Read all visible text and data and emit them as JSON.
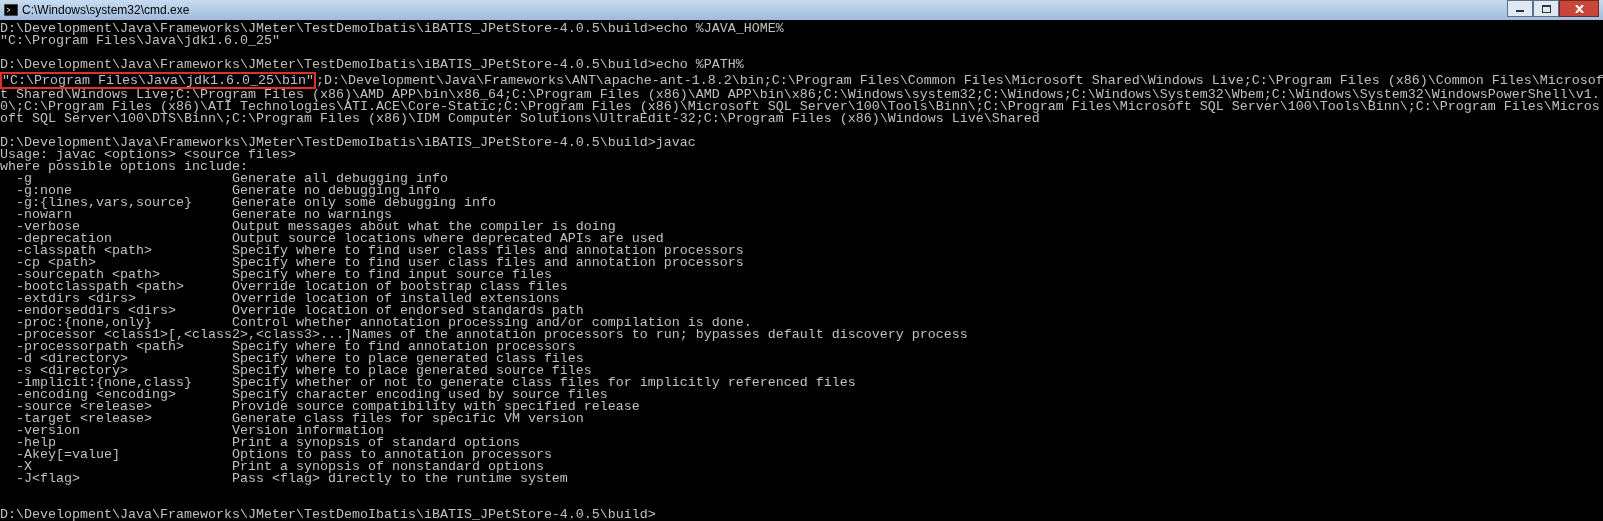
{
  "window": {
    "title": "C:\\Windows\\system32\\cmd.exe"
  },
  "console": {
    "lines": [
      {
        "kind": "text",
        "text": "D:\\Development\\Java\\Frameworks\\JMeter\\TestDemoIbatis\\iBATIS_JPetStore-4.0.5\\build>echo %JAVA_HOME%"
      },
      {
        "kind": "text",
        "text": "\"C:\\Program Files\\Java\\jdk1.6.0_25\""
      },
      {
        "kind": "blank"
      },
      {
        "kind": "text",
        "text": "D:\\Development\\Java\\Frameworks\\JMeter\\TestDemoIbatis\\iBATIS_JPetStore-4.0.5\\build>echo %PATH%"
      },
      {
        "kind": "parts",
        "parts": [
          {
            "text": "\"C:\\Program Files\\Java\\jdk1.6.0_25\\bin\"",
            "highlighted": true
          },
          {
            "text": ";D:\\Development\\Java\\Frameworks\\ANT\\apache-ant-1.8.2\\bin;C:\\Program Files\\Common Files\\Microsoft Shared\\Windows Live;C:\\Program Files (x86)\\Common Files\\Microsof",
            "highlighted": false
          }
        ]
      },
      {
        "kind": "text",
        "text": "t Shared\\Windows Live;C:\\Program Files (x86)\\AMD APP\\bin\\x86_64;C:\\Program Files (x86)\\AMD APP\\bin\\x86;C:\\Windows\\system32;C:\\Windows;C:\\Windows\\System32\\Wbem;C:\\Windows\\System32\\WindowsPowerShell\\v1."
      },
      {
        "kind": "text",
        "text": "0\\;C:\\Program Files (x86)\\ATI Technologies\\ATI.ACE\\Core-Static;C:\\Program Files (x86)\\Microsoft SQL Server\\100\\Tools\\Binn\\;C:\\Program Files\\Microsoft SQL Server\\100\\Tools\\Binn\\;C:\\Program Files\\Micros"
      },
      {
        "kind": "text",
        "text": "oft SQL Server\\100\\DTS\\Binn\\;C:\\Program Files (x86)\\IDM Computer Solutions\\UltraEdit-32;C:\\Program Files (x86)\\Windows Live\\Shared"
      },
      {
        "kind": "blank"
      },
      {
        "kind": "text",
        "text": "D:\\Development\\Java\\Frameworks\\JMeter\\TestDemoIbatis\\iBATIS_JPetStore-4.0.5\\build>javac"
      },
      {
        "kind": "text",
        "text": "Usage: javac <options> <source files>"
      },
      {
        "kind": "text",
        "text": "where possible options include:"
      },
      {
        "kind": "text",
        "text": "  -g                         Generate all debugging info"
      },
      {
        "kind": "text",
        "text": "  -g:none                    Generate no debugging info"
      },
      {
        "kind": "text",
        "text": "  -g:{lines,vars,source}     Generate only some debugging info"
      },
      {
        "kind": "text",
        "text": "  -nowarn                    Generate no warnings"
      },
      {
        "kind": "text",
        "text": "  -verbose                   Output messages about what the compiler is doing"
      },
      {
        "kind": "text",
        "text": "  -deprecation               Output source locations where deprecated APIs are used"
      },
      {
        "kind": "text",
        "text": "  -classpath <path>          Specify where to find user class files and annotation processors"
      },
      {
        "kind": "text",
        "text": "  -cp <path>                 Specify where to find user class files and annotation processors"
      },
      {
        "kind": "text",
        "text": "  -sourcepath <path>         Specify where to find input source files"
      },
      {
        "kind": "text",
        "text": "  -bootclasspath <path>      Override location of bootstrap class files"
      },
      {
        "kind": "text",
        "text": "  -extdirs <dirs>            Override location of installed extensions"
      },
      {
        "kind": "text",
        "text": "  -endorseddirs <dirs>       Override location of endorsed standards path"
      },
      {
        "kind": "text",
        "text": "  -proc:{none,only}          Control whether annotation processing and/or compilation is done."
      },
      {
        "kind": "text",
        "text": "  -processor <class1>[,<class2>,<class3>...]Names of the annotation processors to run; bypasses default discovery process"
      },
      {
        "kind": "text",
        "text": "  -processorpath <path>      Specify where to find annotation processors"
      },
      {
        "kind": "text",
        "text": "  -d <directory>             Specify where to place generated class files"
      },
      {
        "kind": "text",
        "text": "  -s <directory>             Specify where to place generated source files"
      },
      {
        "kind": "text",
        "text": "  -implicit:{none,class}     Specify whether or not to generate class files for implicitly referenced files"
      },
      {
        "kind": "text",
        "text": "  -encoding <encoding>       Specify character encoding used by source files"
      },
      {
        "kind": "text",
        "text": "  -source <release>          Provide source compatibility with specified release"
      },
      {
        "kind": "text",
        "text": "  -target <release>          Generate class files for specific VM version"
      },
      {
        "kind": "text",
        "text": "  -version                   Version information"
      },
      {
        "kind": "text",
        "text": "  -help                      Print a synopsis of standard options"
      },
      {
        "kind": "text",
        "text": "  -Akey[=value]              Options to pass to annotation processors"
      },
      {
        "kind": "text",
        "text": "  -X                         Print a synopsis of nonstandard options"
      },
      {
        "kind": "text",
        "text": "  -J<flag>                   Pass <flag> directly to the runtime system"
      },
      {
        "kind": "blank"
      },
      {
        "kind": "blank"
      },
      {
        "kind": "text",
        "text": "D:\\Development\\Java\\Frameworks\\JMeter\\TestDemoIbatis\\iBATIS_JPetStore-4.0.5\\build>"
      }
    ]
  }
}
